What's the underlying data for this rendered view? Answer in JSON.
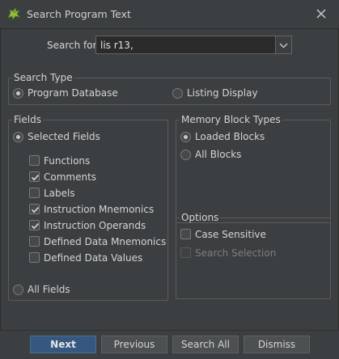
{
  "window": {
    "title": "Search Program Text",
    "icon": "dragon-icon",
    "close_icon": "close-icon"
  },
  "search": {
    "label": "Search for:",
    "value": "lis r13,"
  },
  "search_type": {
    "legend": "Search Type",
    "options": [
      {
        "label": "Program Database",
        "selected": true
      },
      {
        "label": "Listing Display",
        "selected": false
      }
    ]
  },
  "fields": {
    "legend": "Fields",
    "selected_fields_label": "Selected Fields",
    "selected_fields_on": true,
    "items": [
      {
        "label": "Functions",
        "checked": false
      },
      {
        "label": "Comments",
        "checked": true
      },
      {
        "label": "Labels",
        "checked": false
      },
      {
        "label": "Instruction Mnemonics",
        "checked": true
      },
      {
        "label": "Instruction Operands",
        "checked": true
      },
      {
        "label": "Defined Data Mnemonics",
        "checked": false
      },
      {
        "label": "Defined Data Values",
        "checked": false
      }
    ],
    "all_fields_label": "All Fields",
    "all_fields_on": false
  },
  "memory_block_types": {
    "legend": "Memory Block Types",
    "options": [
      {
        "label": "Loaded Blocks",
        "selected": true
      },
      {
        "label": "All Blocks",
        "selected": false
      }
    ]
  },
  "options": {
    "legend": "Options",
    "case_sensitive": {
      "label": "Case Sensitive",
      "checked": false
    },
    "search_selection": {
      "label": "Search Selection",
      "checked": false,
      "enabled": false
    }
  },
  "buttons": {
    "next": "Next",
    "previous": "Previous",
    "search_all": "Search All",
    "dismiss": "Dismiss"
  },
  "colors": {
    "background": "#3c3f41",
    "primary_button": "#365880",
    "field_background": "#2b2b2b"
  }
}
